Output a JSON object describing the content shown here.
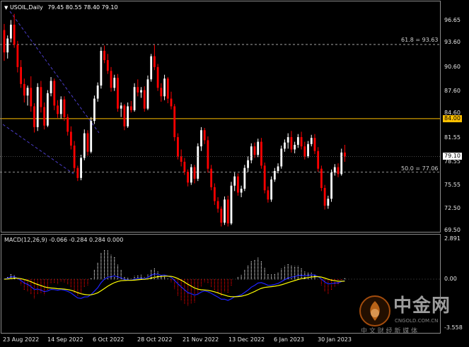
{
  "main_chart": {
    "symbol": "USOIL,Daily",
    "ohlc": "79.45 80.55 78.40 79.10",
    "price_levels": [
      "96.65",
      "93.60",
      "90.60",
      "87.60",
      "84.60",
      "81.55",
      "78.55",
      "75.55",
      "72.50",
      "69.50"
    ],
    "highlight_level": "84.00",
    "current_price": "79.10",
    "fib_618_label": "61.8 = 93.63",
    "fib_500_label": "50.0 = 77.06",
    "colors": {
      "up": "#ffffff",
      "down": "#ff0000",
      "level_line": "#ffc000",
      "fib_line": "#bdbdbd",
      "trend_line": "#4b3cc8"
    }
  },
  "macd": {
    "label": "MACD(12,26,9) -0.066 -0.284 0.284 0.000",
    "levels": [
      "2.891",
      "0.00",
      "-3.558"
    ],
    "colors": {
      "macd_line": "#1e22ff",
      "signal_line": "#ffff00",
      "hist_pos": "#ffffff",
      "hist_neg": "#ff0000"
    }
  },
  "date_axis": [
    "23 Aug 2022",
    "14 Sep 2022",
    "6 Oct 2022",
    "28 Oct 2022",
    "21 Nov 2022",
    "13 Dec 2022",
    "6 Jan 2023",
    "30 Jan 2023"
  ],
  "watermark": {
    "brand": "中金网",
    "domain": "CNGOLD.COM.CN",
    "slogan": "中 文 财 经 新 媒 体"
  },
  "candles": [
    [
      95.5,
      96.3,
      91.5,
      92.6
    ],
    [
      92.6,
      94.8,
      91.8,
      94.4
    ],
    [
      94.4,
      96.8,
      93.9,
      96.2
    ],
    [
      96.2,
      97.6,
      93.2,
      93.6
    ],
    [
      93.6,
      94.1,
      90.0,
      90.7
    ],
    [
      90.7,
      91.6,
      88.0,
      88.5
    ],
    [
      88.5,
      89.2,
      86.1,
      87.0
    ],
    [
      87.0,
      88.3,
      85.7,
      88.0
    ],
    [
      88.0,
      89.5,
      84.9,
      85.6
    ],
    [
      85.6,
      86.0,
      82.2,
      82.9
    ],
    [
      82.9,
      88.6,
      82.4,
      88.1
    ],
    [
      88.1,
      88.9,
      84.8,
      85.5
    ],
    [
      85.5,
      86.1,
      82.6,
      83.1
    ],
    [
      83.1,
      87.7,
      82.9,
      87.3
    ],
    [
      87.3,
      89.4,
      86.9,
      88.9
    ],
    [
      88.9,
      89.2,
      85.1,
      85.7
    ],
    [
      85.7,
      86.4,
      84.1,
      84.6
    ],
    [
      84.6,
      86.9,
      84.0,
      86.5
    ],
    [
      86.5,
      86.9,
      83.7,
      84.2
    ],
    [
      84.2,
      84.6,
      81.8,
      82.3
    ],
    [
      82.3,
      83.0,
      80.0,
      80.5
    ],
    [
      80.5,
      81.1,
      77.1,
      77.6
    ],
    [
      77.6,
      77.9,
      75.9,
      76.3
    ],
    [
      76.3,
      79.3,
      76.0,
      78.9
    ],
    [
      78.9,
      82.6,
      78.6,
      82.1
    ],
    [
      82.1,
      82.5,
      79.2,
      79.7
    ],
    [
      79.7,
      84.2,
      79.5,
      83.7
    ],
    [
      83.7,
      87.0,
      83.3,
      86.6
    ],
    [
      86.6,
      88.7,
      86.2,
      88.3
    ],
    [
      88.3,
      93.3,
      87.9,
      92.8
    ],
    [
      92.8,
      93.5,
      91.2,
      91.6
    ],
    [
      91.6,
      92.4,
      89.8,
      90.2
    ],
    [
      90.2,
      90.7,
      87.5,
      88.0
    ],
    [
      88.0,
      89.7,
      87.6,
      89.3
    ],
    [
      89.3,
      89.8,
      84.9,
      85.3
    ],
    [
      85.3,
      86.1,
      84.2,
      85.7
    ],
    [
      85.7,
      85.9,
      82.5,
      83.0
    ],
    [
      83.0,
      86.1,
      82.8,
      85.6
    ],
    [
      85.6,
      86.3,
      84.8,
      85.1
    ],
    [
      85.1,
      88.6,
      84.9,
      88.1
    ],
    [
      88.1,
      89.1,
      86.9,
      87.4
    ],
    [
      87.4,
      88.1,
      86.7,
      87.7
    ],
    [
      87.7,
      88.2,
      84.9,
      85.3
    ],
    [
      85.3,
      89.6,
      85.1,
      89.1
    ],
    [
      89.1,
      92.4,
      88.8,
      92.1
    ],
    [
      92.1,
      93.6,
      90.3,
      90.7
    ],
    [
      90.7,
      91.1,
      87.6,
      88.0
    ],
    [
      88.0,
      88.6,
      86.2,
      86.9
    ],
    [
      86.9,
      89.7,
      86.4,
      89.2
    ],
    [
      89.2,
      89.4,
      86.0,
      86.6
    ],
    [
      86.6,
      87.5,
      85.2,
      85.6
    ],
    [
      85.6,
      85.9,
      81.1,
      81.6
    ],
    [
      81.6,
      82.1,
      78.7,
      79.1
    ],
    [
      79.1,
      80.0,
      77.8,
      78.4
    ],
    [
      78.4,
      78.9,
      76.7,
      77.1
    ],
    [
      77.1,
      77.4,
      75.2,
      75.7
    ],
    [
      75.7,
      78.1,
      75.4,
      77.7
    ],
    [
      77.7,
      78.0,
      75.6,
      76.2
    ],
    [
      76.2,
      80.8,
      75.9,
      80.4
    ],
    [
      80.4,
      82.9,
      79.8,
      82.5
    ],
    [
      82.5,
      82.8,
      80.7,
      81.2
    ],
    [
      81.2,
      81.7,
      77.0,
      77.5
    ],
    [
      77.5,
      78.0,
      74.7,
      75.1
    ],
    [
      75.1,
      75.6,
      72.8,
      73.3
    ],
    [
      73.3,
      73.8,
      71.8,
      72.3
    ],
    [
      72.3,
      72.6,
      70.0,
      70.5
    ],
    [
      70.5,
      73.9,
      70.2,
      73.5
    ],
    [
      73.5,
      74.0,
      70.0,
      70.4
    ],
    [
      70.4,
      75.8,
      70.2,
      75.3
    ],
    [
      75.3,
      77.0,
      74.6,
      76.5
    ],
    [
      76.5,
      76.9,
      74.0,
      74.4
    ],
    [
      74.4,
      75.3,
      73.8,
      74.9
    ],
    [
      74.9,
      78.0,
      74.6,
      77.6
    ],
    [
      77.6,
      79.1,
      77.1,
      78.6
    ],
    [
      78.6,
      80.8,
      78.2,
      80.4
    ],
    [
      80.4,
      80.9,
      78.9,
      79.3
    ],
    [
      79.3,
      81.4,
      79.0,
      81.0
    ],
    [
      81.0,
      81.5,
      77.5,
      77.9
    ],
    [
      77.9,
      78.3,
      74.3,
      74.7
    ],
    [
      74.7,
      75.2,
      73.1,
      73.5
    ],
    [
      73.5,
      76.5,
      73.2,
      76.1
    ],
    [
      76.1,
      77.6,
      75.8,
      77.2
    ],
    [
      77.2,
      78.2,
      76.9,
      77.8
    ],
    [
      77.8,
      80.5,
      77.5,
      80.1
    ],
    [
      80.1,
      81.3,
      79.7,
      80.9
    ],
    [
      80.9,
      82.1,
      80.1,
      81.6
    ],
    [
      81.6,
      82.4,
      79.6,
      80.0
    ],
    [
      80.0,
      81.0,
      79.5,
      80.6
    ],
    [
      80.6,
      82.0,
      80.2,
      81.6
    ],
    [
      81.6,
      82.3,
      80.0,
      80.4
    ],
    [
      80.4,
      81.0,
      78.7,
      79.1
    ],
    [
      79.1,
      81.1,
      78.9,
      80.7
    ],
    [
      80.7,
      81.9,
      80.4,
      81.5
    ],
    [
      81.5,
      82.0,
      79.4,
      79.8
    ],
    [
      79.8,
      80.3,
      77.1,
      77.5
    ],
    [
      77.5,
      77.9,
      74.6,
      75.0
    ],
    [
      75.0,
      75.4,
      72.2,
      72.7
    ],
    [
      72.7,
      74.0,
      72.3,
      73.6
    ],
    [
      73.6,
      77.4,
      73.2,
      77.0
    ],
    [
      77.0,
      78.1,
      76.6,
      77.7
    ],
    [
      77.7,
      78.2,
      76.4,
      76.8
    ],
    [
      76.8,
      80.1,
      76.6,
      79.6
    ],
    [
      79.6,
      80.6,
      78.4,
      79.1
    ]
  ]
}
